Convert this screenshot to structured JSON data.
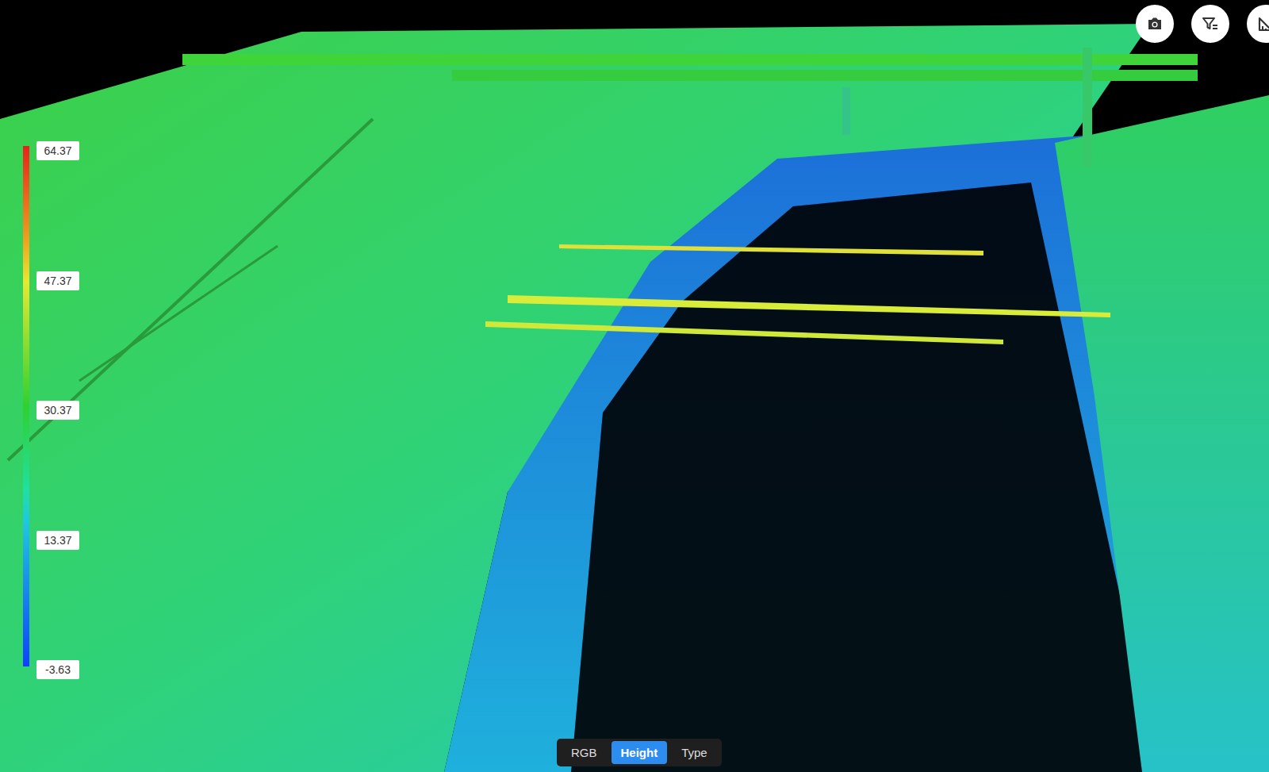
{
  "legend": {
    "ticks": [
      "64.37",
      "47.37",
      "30.37",
      "13.37",
      "-3.63"
    ]
  },
  "view_tabs": [
    {
      "label": "RGB",
      "selected": false
    },
    {
      "label": "Height",
      "selected": true
    },
    {
      "label": "Type",
      "selected": false
    }
  ]
}
